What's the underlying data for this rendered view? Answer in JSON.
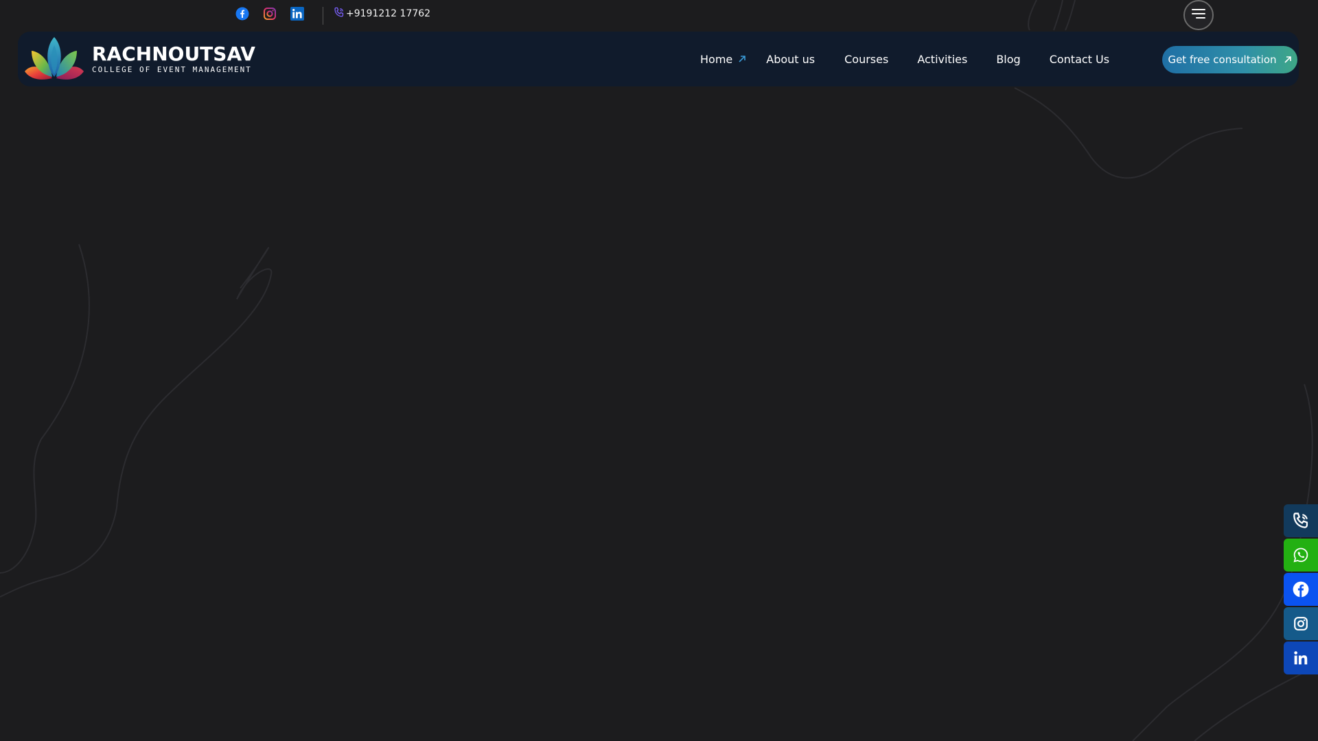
{
  "topbar": {
    "social_icons": [
      "facebook-icon",
      "instagram-icon",
      "linkedin-icon"
    ],
    "phone": "+9191212 17762"
  },
  "header": {
    "logo_title": "RACHNOUTSAV",
    "logo_subtitle": "COLLEGE OF EVENT MANAGEMENT",
    "nav": {
      "home": "Home",
      "about": "About us",
      "courses": "Courses",
      "activities": "Activities",
      "blog": "Blog",
      "contact": "Contact Us"
    },
    "cta": "Get free consultation"
  },
  "floating_buttons": [
    {
      "icon": "phone-icon",
      "color": "#123a5c"
    },
    {
      "icon": "whatsapp-icon",
      "color": "#23b012"
    },
    {
      "icon": "facebook-icon",
      "color": "#0a53f0"
    },
    {
      "icon": "instagram-icon",
      "color": "#155a8a"
    },
    {
      "icon": "linkedin-icon",
      "color": "#0d47b8"
    }
  ],
  "colors": {
    "background": "#1c1c1e",
    "header": "#101b2c",
    "accent": "#2f8fa8"
  }
}
